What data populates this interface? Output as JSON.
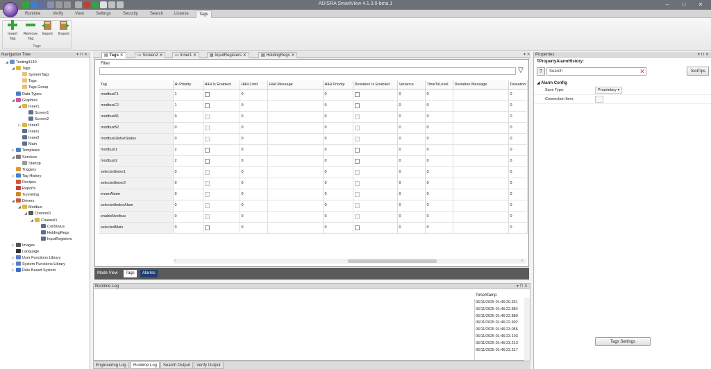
{
  "app": {
    "title": "ADISRA SmartView 4.1.3.0-beta.1"
  },
  "ribbon_tabs": [
    "Runtime",
    "Verify",
    "View",
    "Settings",
    "Security",
    "Search",
    "License",
    "Tags"
  ],
  "ribbon": {
    "buttons": [
      {
        "label1": "Insert",
        "label2": "Tag"
      },
      {
        "label1": "Remove",
        "label2": "Tag"
      },
      {
        "label1": "Import",
        "label2": ""
      },
      {
        "label1": "Export",
        "label2": ""
      }
    ],
    "group_label": "Tags"
  },
  "navigation_tree": {
    "title": "Navigation Tree",
    "nodes": [
      {
        "label": "Testing4130",
        "level": 0,
        "arrow": "◢",
        "icon": "project-icon",
        "color": "#6a8fcf"
      },
      {
        "label": "Tags",
        "level": 1,
        "arrow": "◢",
        "icon": "folder-icon",
        "color": "#e0b440"
      },
      {
        "label": "SystemTags",
        "level": 2,
        "arrow": "",
        "icon": "tag-icon",
        "color": "#e6c27a"
      },
      {
        "label": "Tags",
        "level": 2,
        "arrow": "",
        "icon": "tag-icon",
        "color": "#e6c27a"
      },
      {
        "label": "Tags Group",
        "level": 2,
        "arrow": "",
        "icon": "tag-group-icon",
        "color": "#e6c27a"
      },
      {
        "label": "Data Types",
        "level": 1,
        "arrow": "",
        "icon": "datatype-icon",
        "color": "#4a7fc4"
      },
      {
        "label": "Graphics",
        "level": 1,
        "arrow": "◢",
        "icon": "graphics-icon",
        "color": "#c35aa8"
      },
      {
        "label": "Inner1",
        "level": 2,
        "arrow": "◢",
        "icon": "folder-icon",
        "color": "#e0b440"
      },
      {
        "label": "Screen1",
        "level": 3,
        "arrow": "",
        "icon": "screen-icon",
        "color": "#5d6f8c"
      },
      {
        "label": "Screen2",
        "level": 3,
        "arrow": "",
        "icon": "screen-icon",
        "color": "#5d6f8c"
      },
      {
        "label": "Inner2",
        "level": 2,
        "arrow": "▷",
        "icon": "folder-icon",
        "color": "#e0b440"
      },
      {
        "label": "Inner1",
        "level": 2,
        "arrow": "",
        "icon": "screen-icon",
        "color": "#5d6f8c"
      },
      {
        "label": "Inner2",
        "level": 2,
        "arrow": "",
        "icon": "screen-icon",
        "color": "#5d6f8c"
      },
      {
        "label": "Main",
        "level": 2,
        "arrow": "",
        "icon": "screen-icon",
        "color": "#5d6f8c"
      },
      {
        "label": "Templates",
        "level": 1,
        "arrow": "▷",
        "icon": "templates-icon",
        "color": "#4a7fc4"
      },
      {
        "label": "Services",
        "level": 1,
        "arrow": "◢",
        "icon": "services-icon",
        "color": "#7a7a7a"
      },
      {
        "label": "Startup",
        "level": 2,
        "arrow": "",
        "icon": "startup-icon",
        "color": "#9a9a9a"
      },
      {
        "label": "Triggers",
        "level": 1,
        "arrow": "",
        "icon": "triggers-icon",
        "color": "#e09a2a"
      },
      {
        "label": "Tag History",
        "level": 1,
        "arrow": "▷",
        "icon": "history-icon",
        "color": "#4a7fc4"
      },
      {
        "label": "Recipes",
        "level": 1,
        "arrow": "",
        "icon": "recipes-icon",
        "color": "#c95a3a"
      },
      {
        "label": "Reports",
        "level": 1,
        "arrow": "",
        "icon": "reports-icon",
        "color": "#c9403a"
      },
      {
        "label": "Tunneling",
        "level": 1,
        "arrow": "",
        "icon": "tunneling-icon",
        "color": "#c98a2a"
      },
      {
        "label": "Drivers",
        "level": 1,
        "arrow": "◢",
        "icon": "drivers-icon",
        "color": "#c95a3a"
      },
      {
        "label": "Modbus",
        "level": 2,
        "arrow": "◢",
        "icon": "folder-icon",
        "color": "#e0b440"
      },
      {
        "label": "Channel1",
        "level": 3,
        "arrow": "◢",
        "icon": "channel-icon",
        "color": "#5a5a5a"
      },
      {
        "label": "Channel1",
        "level": 4,
        "arrow": "◢",
        "icon": "folder-icon",
        "color": "#e0b440"
      },
      {
        "label": "CoilStatus",
        "level": 5,
        "arrow": "",
        "icon": "node-icon",
        "color": "#5d6f8c"
      },
      {
        "label": "HoldingRegs",
        "level": 5,
        "arrow": "",
        "icon": "node-icon",
        "color": "#5d6f8c"
      },
      {
        "label": "InputRegisters",
        "level": 5,
        "arrow": "",
        "icon": "node-icon",
        "color": "#5d6f8c"
      },
      {
        "label": "Images",
        "level": 1,
        "arrow": "▷",
        "icon": "images-icon",
        "color": "#555"
      },
      {
        "label": "Language",
        "level": 1,
        "arrow": "",
        "icon": "language-icon",
        "color": "#333"
      },
      {
        "label": "User Functions Library",
        "level": 1,
        "arrow": "▷",
        "icon": "library-icon",
        "color": "#5a7fc4"
      },
      {
        "label": "System Functions Library",
        "level": 1,
        "arrow": "▷",
        "icon": "library-icon",
        "color": "#5a7fc4"
      },
      {
        "label": "Rule Based System",
        "level": 1,
        "arrow": "▷",
        "icon": "rules-icon",
        "color": "#3a6fc4"
      }
    ]
  },
  "doc_tabs": [
    "Tags",
    "Screen2",
    "Inner1",
    "InputRegisters",
    "HoldingRegs"
  ],
  "grid": {
    "filter_label": "Filter",
    "columns": [
      "Tag",
      "Hi Priority",
      "HiHi Is Enabled",
      "HiHi Limit",
      "HiHi Message",
      "HiHi Priority",
      "Deviation Is Enabled",
      "Variance",
      "TimeToLevel",
      "Deviation Message",
      "Deviation"
    ],
    "rows": [
      {
        "tag": "modbusF1",
        "hi_priority": "1",
        "hihi_limit": "0",
        "hihi_priority": "0",
        "variance": "0",
        "timetolevel": "0",
        "deviation": "0",
        "enabled": true
      },
      {
        "tag": "modbusF2",
        "hi_priority": "1",
        "hihi_limit": "0",
        "hihi_priority": "0",
        "variance": "0",
        "timetolevel": "0",
        "deviation": "0",
        "enabled": true
      },
      {
        "tag": "modbusB1",
        "hi_priority": "0",
        "hihi_limit": "0",
        "hihi_priority": "0",
        "variance": "0",
        "timetolevel": "0",
        "deviation": "0",
        "enabled": false
      },
      {
        "tag": "modbusB2",
        "hi_priority": "0",
        "hihi_limit": "0",
        "hihi_priority": "0",
        "variance": "0",
        "timetolevel": "0",
        "deviation": "0",
        "enabled": false
      },
      {
        "tag": "modbusGlobalStatus",
        "hi_priority": "0",
        "hihi_limit": "0",
        "hihi_priority": "0",
        "variance": "0",
        "timetolevel": "0",
        "deviation": "0",
        "enabled": false
      },
      {
        "tag": "modbusI1",
        "hi_priority": "2",
        "hihi_limit": "0",
        "hihi_priority": "0",
        "variance": "0",
        "timetolevel": "0",
        "deviation": "0",
        "enabled": true
      },
      {
        "tag": "modbusI2",
        "hi_priority": "2",
        "hihi_limit": "0",
        "hihi_priority": "0",
        "variance": "0",
        "timetolevel": "0",
        "deviation": "0",
        "enabled": true
      },
      {
        "tag": "selectedInner1",
        "hi_priority": "0",
        "hihi_limit": "0",
        "hihi_priority": "0",
        "variance": "0",
        "timetolevel": "0",
        "deviation": "0",
        "enabled": false
      },
      {
        "tag": "selectedInner2",
        "hi_priority": "0",
        "hihi_limit": "0",
        "hihi_priority": "0",
        "variance": "0",
        "timetolevel": "0",
        "deviation": "0",
        "enabled": false
      },
      {
        "tag": "enumAlarm",
        "hi_priority": "0",
        "hihi_limit": "0",
        "hihi_priority": "0",
        "variance": "0",
        "timetolevel": "0",
        "deviation": "0",
        "enabled": false
      },
      {
        "tag": "selectedIndexAlam",
        "hi_priority": "0",
        "hihi_limit": "0",
        "hihi_priority": "0",
        "variance": "0",
        "timetolevel": "0",
        "deviation": "0",
        "enabled": false
      },
      {
        "tag": "enableModbus",
        "hi_priority": "0",
        "hihi_limit": "0",
        "hihi_priority": "0",
        "variance": "0",
        "timetolevel": "0",
        "deviation": "0",
        "enabled": false
      },
      {
        "tag": "selectedMain",
        "hi_priority": "0",
        "hihi_limit": "0",
        "hihi_priority": "0",
        "variance": "0",
        "timetolevel": "0",
        "deviation": "0",
        "enabled": true
      }
    ]
  },
  "mode_view": {
    "label": "Mode View",
    "tags_button": "Tags",
    "alarms_button": "Alarms"
  },
  "runtime_log": {
    "title": "Runtime Log",
    "timestamp_header": "TimeStamp",
    "entries": [
      "06/11/2025 01:46:20.331",
      "06/11/2025 01:46:22.884",
      "06/11/2025 01:46:22.889",
      "06/11/2025 01:46:22.992",
      "06/11/2025 01:46:23.055",
      "06/11/2025 01:46:23.103",
      "06/11/2025 01:46:23.213",
      "06/11/2025 01:46:23.317"
    ]
  },
  "bottom_tabs": [
    "Engineering Log",
    "Runtime Log",
    "Search Output",
    "Verify Output"
  ],
  "properties": {
    "title": "Properties",
    "object_title": "TPropertyAlarmHistory:",
    "search_placeholder": "Search",
    "tooltips_button": "ToolTips",
    "category": "Alarm Config",
    "rows": [
      {
        "name": "Save Type:",
        "value": "Proprietary"
      },
      {
        "name": "Connection Item:",
        "value": ""
      }
    ],
    "tags_settings_button": "Tags Settings"
  },
  "colors": {
    "accent_purple": "#6f3fa8",
    "ribbon_green": "#2fa83a",
    "mode_active": "#1f3f73"
  }
}
